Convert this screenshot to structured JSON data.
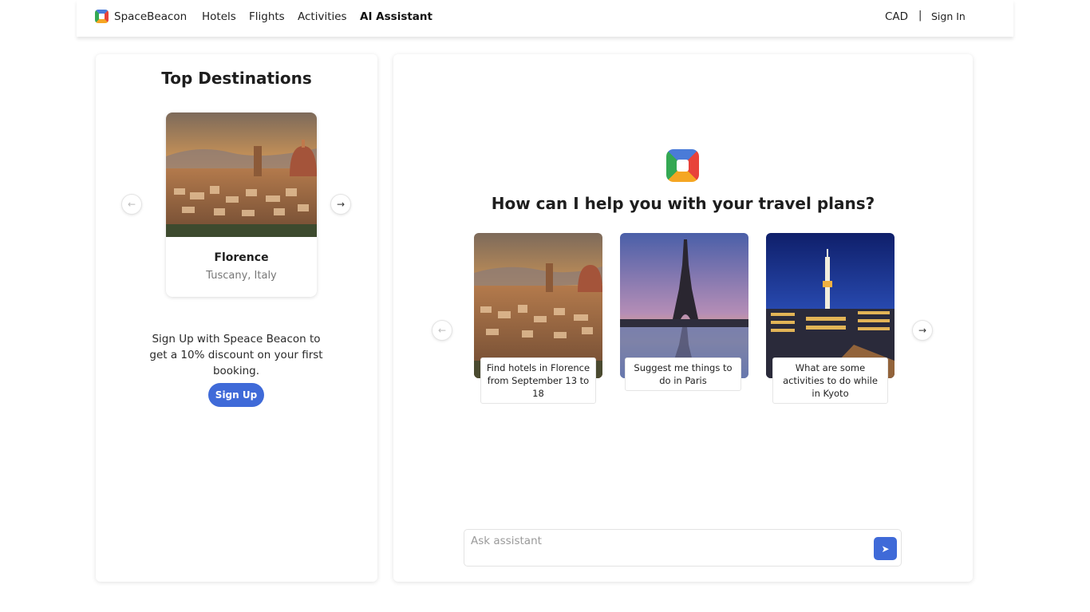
{
  "nav": {
    "brand": "SpaceBeacon",
    "links": [
      "Hotels",
      "Flights",
      "Activities",
      "AI Assistant"
    ],
    "currency": "CAD",
    "separator": "|",
    "sign_in": "Sign In"
  },
  "left_panel": {
    "title": "Top Destinations",
    "destination": {
      "name": "Florence",
      "location": "Tuscany, Italy"
    },
    "promo": "Sign Up with Speace Beacon to get a 10% discount on your first booking.",
    "signup_label": "Sign Up"
  },
  "assistant": {
    "heading": "How can I help you with your travel plans?",
    "suggestions": [
      {
        "label": "Find hotels in Florence from September 13 to 18",
        "image": "florence-image"
      },
      {
        "label": "Suggest me things to do in Paris",
        "image": "paris-eiffel-image"
      },
      {
        "label": "What are some activities to do while in Kyoto",
        "image": "kyoto-tower-image"
      }
    ],
    "ask_placeholder": "Ask assistant",
    "ask_value": ""
  },
  "icons": {
    "prev": "arrow-left-icon",
    "next": "arrow-right-icon",
    "send": "send-icon"
  },
  "colors": {
    "accent": "#3f6ad8"
  }
}
